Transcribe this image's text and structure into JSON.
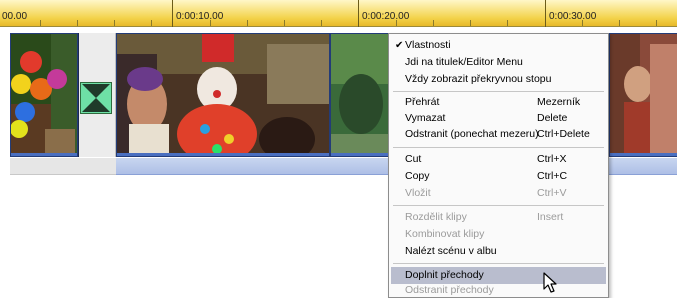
{
  "ruler": {
    "labels": [
      "00.00",
      "0:00:10.00",
      "0:00:20.00",
      "0:00:30.00"
    ]
  },
  "timeline": {
    "clips": [
      "clip-balloons",
      "clip-transition",
      "clip-clown",
      "clip-green",
      "clip-right"
    ]
  },
  "menu": {
    "items": [
      {
        "label": "Vlastnosti",
        "shortcut": "",
        "checked": true,
        "enabled": true
      },
      {
        "label": "Jdi na titulek/Editor Menu",
        "shortcut": "",
        "enabled": true
      },
      {
        "label": "Vždy zobrazit překryvnou stopu",
        "shortcut": "",
        "enabled": true
      },
      {
        "label": "Přehrát",
        "shortcut": "Mezerník",
        "enabled": true
      },
      {
        "label": "Vymazat",
        "shortcut": "Delete",
        "enabled": true
      },
      {
        "label": "Odstranit (ponechat mezeru)",
        "shortcut": "Ctrl+Delete",
        "enabled": true
      },
      {
        "label": "Cut",
        "shortcut": "Ctrl+X",
        "enabled": true
      },
      {
        "label": "Copy",
        "shortcut": "Ctrl+C",
        "enabled": true
      },
      {
        "label": "Vložit",
        "shortcut": "Ctrl+V",
        "enabled": false
      },
      {
        "label": "Rozdělit klipy",
        "shortcut": "Insert",
        "enabled": false
      },
      {
        "label": "Kombinovat klipy",
        "shortcut": "",
        "enabled": false
      },
      {
        "label": "Nalézt scénu v albu",
        "shortcut": "",
        "enabled": true
      },
      {
        "label": "Doplnit přechody",
        "shortcut": "",
        "enabled": true,
        "highlighted": true
      },
      {
        "label": "Odstranit přechody",
        "shortcut": "",
        "enabled": false
      }
    ]
  },
  "colors": {
    "ruler_gold": "#f3d24a",
    "menu_highlight": "#b9bdce",
    "transition_green": "#6ee0a6",
    "clip_border": "#233c78"
  }
}
